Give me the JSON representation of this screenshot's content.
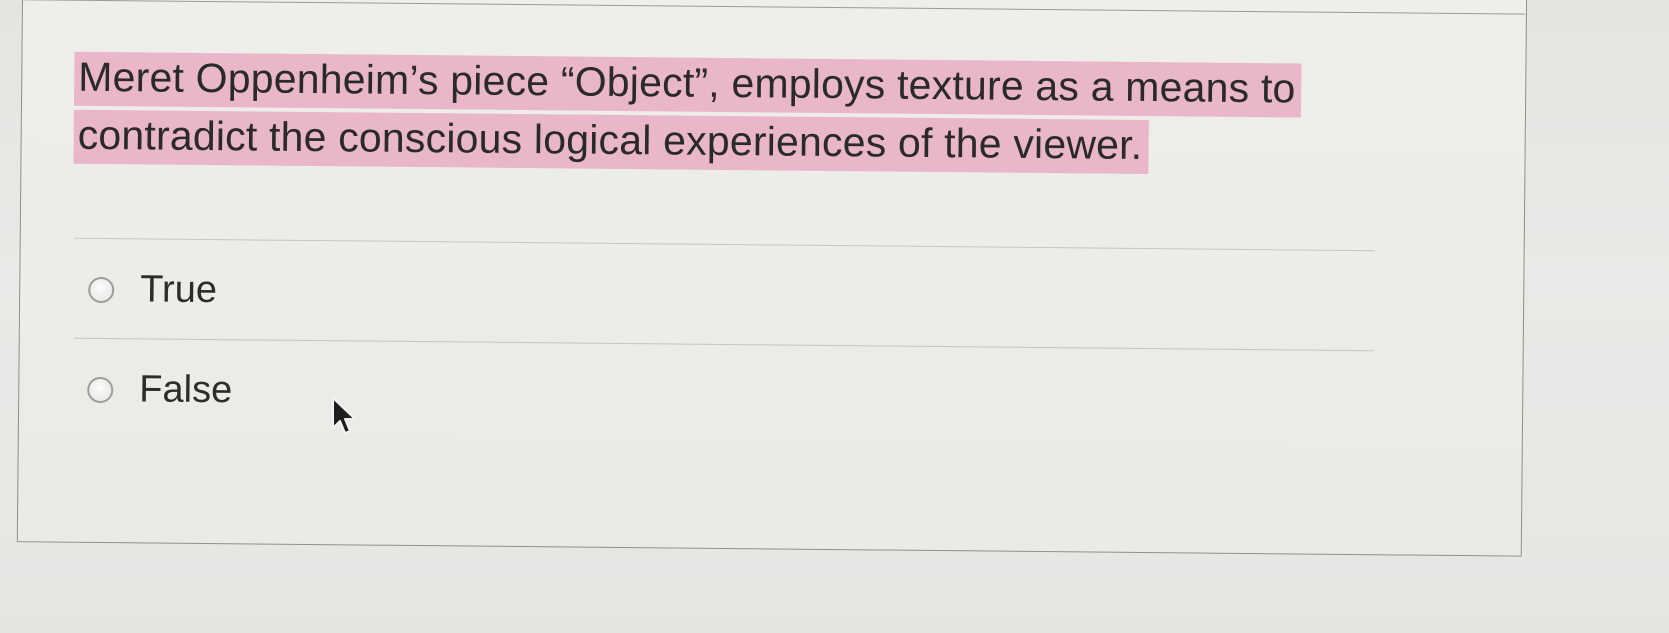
{
  "question": {
    "text": "Meret Oppenheim’s piece “Object”, employs texture as a means to contradict the conscious logical experiences of the viewer.",
    "highlight_color": "#e9b7c9"
  },
  "options": [
    {
      "label": "True",
      "selected": false
    },
    {
      "label": "False",
      "selected": false
    }
  ],
  "icons": {
    "cursor": "mouse-pointer-icon"
  }
}
